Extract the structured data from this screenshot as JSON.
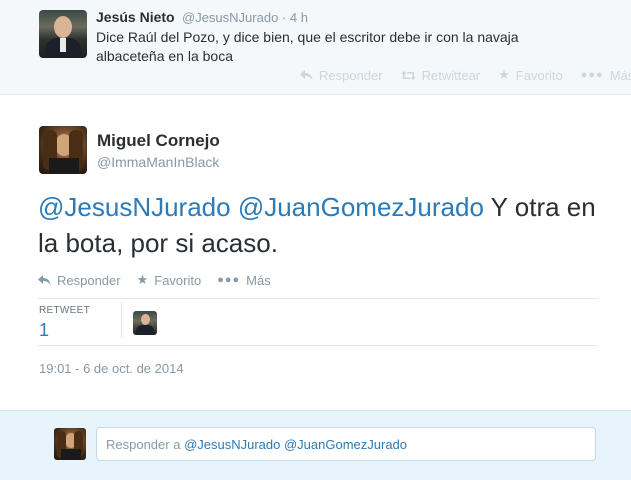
{
  "previous_tweet": {
    "name": "Jesús Nieto",
    "handle": "@JesusNJurado",
    "time": "· 4 h",
    "text": "Dice Raúl del Pozo, y dice bien, que el escritor debe ir con la navaja albaceteña en la boca",
    "actions": {
      "reply": "Responder",
      "retweet": "Retwittear",
      "favorite": "Favorito",
      "more": "Más"
    }
  },
  "main_tweet": {
    "name": "Miguel Cornejo",
    "handle": "@ImmaManInBlack",
    "mention1": "@JesusNJurado",
    "mention2": "@JuanGomezJurado",
    "text_rest": " Y otra en la bota, por si acaso.",
    "actions": {
      "reply": "Responder",
      "favorite": "Favorito",
      "more": "Más"
    },
    "retweet_label": "RETWEET",
    "retweet_count": "1",
    "timestamp": "19:01 - 6 de oct. de 2014"
  },
  "reply_box": {
    "prefix": "Responder a ",
    "mention1": "@JesusNJurado",
    "mention2": "@JuanGomezJurado"
  },
  "colors": {
    "link": "#2b7bb9",
    "muted": "#8899a6",
    "reply_bg": "#e8f4fb"
  }
}
